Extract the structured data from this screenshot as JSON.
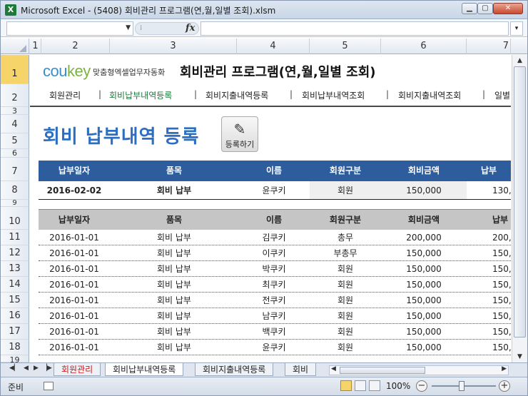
{
  "window": {
    "title": "Microsoft Excel - (5408) 회비관리 프로그램(연,월,일별 조회).xlsm",
    "app_icon": "X"
  },
  "formula_bar": {
    "name_box": "",
    "fx_label": "fx",
    "formula": ""
  },
  "columns": [
    "1",
    "2",
    "3",
    "4",
    "5",
    "6",
    "7"
  ],
  "rows": [
    "1",
    "2",
    "3",
    "4",
    "5",
    "6",
    "7",
    "8",
    "9",
    "10",
    "11",
    "12",
    "13",
    "14",
    "15",
    "16",
    "17",
    "18",
    "19"
  ],
  "header": {
    "logo_cou": "cou",
    "logo_key": "key",
    "tagline": "맞춤형엑셀업무자동화",
    "app_title": "회비관리 프로그램(연,월,일별 조회)"
  },
  "nav": [
    "회원관리",
    "회비납부내역등록",
    "회비지출내역등록",
    "회비납부내역조회",
    "회비지출내역조회",
    "일별"
  ],
  "page_title": "회비 납부내역 등록",
  "register_button": "등록하기",
  "table_headers": [
    "납부일자",
    "품목",
    "이름",
    "회원구분",
    "회비금액",
    "납부"
  ],
  "input_row": [
    "2016-02-02",
    "회비 납부",
    "윤쿠키",
    "회원",
    "150,000",
    "130,"
  ],
  "records": [
    [
      "2016-01-01",
      "회비 납부",
      "김쿠키",
      "총무",
      "200,000",
      "200,"
    ],
    [
      "2016-01-01",
      "회비 납부",
      "이쿠키",
      "부총무",
      "150,000",
      "150,"
    ],
    [
      "2016-01-01",
      "회비 납부",
      "박쿠키",
      "회원",
      "150,000",
      "150,"
    ],
    [
      "2016-01-01",
      "회비 납부",
      "최쿠키",
      "회원",
      "150,000",
      "150,"
    ],
    [
      "2016-01-01",
      "회비 납부",
      "전쿠키",
      "회원",
      "150,000",
      "150,"
    ],
    [
      "2016-01-01",
      "회비 납부",
      "남쿠키",
      "회원",
      "150,000",
      "150,"
    ],
    [
      "2016-01-01",
      "회비 납부",
      "백쿠키",
      "회원",
      "150,000",
      "150,"
    ],
    [
      "2016-01-01",
      "회비 납부",
      "윤쿠키",
      "회원",
      "150,000",
      "150,"
    ]
  ],
  "sheet_tabs": [
    "회원관리",
    "회비납부내역등록",
    "회비지출내역등록",
    "회비"
  ],
  "status": {
    "ready": "준비",
    "zoom": "100%"
  },
  "colors": {
    "accent_blue": "#2e5d9e",
    "title_blue": "#2c6fc2",
    "nav_active": "#1f7a3a",
    "selected_row": "#f7d46a"
  }
}
